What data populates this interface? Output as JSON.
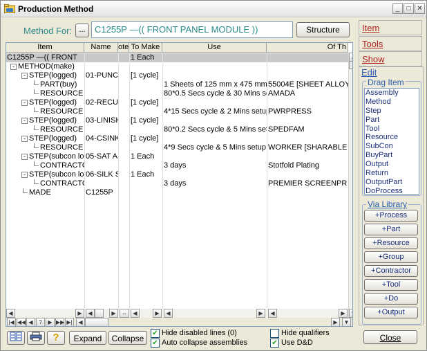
{
  "window": {
    "title": "Production Method",
    "controls": [
      "_",
      "□",
      "✕"
    ]
  },
  "method": {
    "label": "Method For:",
    "browse_label": "...",
    "value": "C1255P    —(( FRONT PANEL MODULE ))",
    "structure_label": "Structure"
  },
  "tree": {
    "columns": [
      "Item",
      "Name",
      "ote",
      "To Make",
      "Use",
      "Of Th"
    ],
    "rows": [
      {
        "item": "C1255P   —(( FRONT",
        "name": "",
        "note": "",
        "tomake": "1 Each",
        "use": "",
        "of": "",
        "indent": 0,
        "expander": "",
        "selected": true
      },
      {
        "item": "METHOD(make)",
        "name": "",
        "note": "",
        "tomake": "",
        "use": "",
        "of": "",
        "indent": 1,
        "expander": "-"
      },
      {
        "item": "STEP(logged)",
        "name": "01-PUNC",
        "note": "",
        "tomake": "[1 cycle]",
        "use": "",
        "of": "",
        "indent": 2,
        "expander": "-"
      },
      {
        "item": "PART(buy)",
        "name": "",
        "note": "",
        "tomake": "",
        "use": "1 Sheets of 125 mm x 475 mm",
        "of": "55004E [SHEET ALLOY",
        "indent": 3,
        "expander": ""
      },
      {
        "item": "RESOURCE",
        "name": "",
        "note": "",
        "tomake": "",
        "use": "80*0.5 Secs cycle & 30 Mins se",
        "of": "AMADA",
        "indent": 3,
        "expander": ""
      },
      {
        "item": "STEP(logged)",
        "name": "02-RECU",
        "note": "",
        "tomake": "[1 cycle]",
        "use": "",
        "of": "",
        "indent": 2,
        "expander": "-"
      },
      {
        "item": "RESOURCE",
        "name": "",
        "note": "",
        "tomake": "",
        "use": "4*15 Secs cycle & 2 Mins setup",
        "of": "PWRPRESS",
        "indent": 3,
        "expander": ""
      },
      {
        "item": "STEP(logged)",
        "name": "03-LINISH",
        "note": "",
        "tomake": "[1 cycle]",
        "use": "",
        "of": "",
        "indent": 2,
        "expander": "-"
      },
      {
        "item": "RESOURCE",
        "name": "",
        "note": "",
        "tomake": "",
        "use": "80*0.2 Secs cycle & 5 Mins setu",
        "of": "SPEDFAM",
        "indent": 3,
        "expander": ""
      },
      {
        "item": "STEP(logged)",
        "name": "04-CSINK",
        "note": "",
        "tomake": "[1 cycle]",
        "use": "",
        "of": "",
        "indent": 2,
        "expander": "-"
      },
      {
        "item": "RESOURCE",
        "name": "",
        "note": "",
        "tomake": "",
        "use": "4*9 Secs cycle & 5 Mins setup",
        "of": "WORKER [SHARABLE",
        "indent": 3,
        "expander": ""
      },
      {
        "item": "STEP(subcon lo",
        "name": "05-SAT A",
        "note": "",
        "tomake": "1 Each",
        "use": "",
        "of": "",
        "indent": 2,
        "expander": "-"
      },
      {
        "item": "CONTRACTO",
        "name": "",
        "note": "",
        "tomake": "",
        "use": "3 days",
        "of": "Stotfold Plating",
        "indent": 3,
        "expander": ""
      },
      {
        "item": "STEP(subcon lo",
        "name": "06-SILK S",
        "note": "",
        "tomake": "1 Each",
        "use": "",
        "of": "",
        "indent": 2,
        "expander": "-"
      },
      {
        "item": "CONTRACTO",
        "name": "",
        "note": "",
        "tomake": "",
        "use": "3 days",
        "of": "PREMIER SCREENPR",
        "indent": 3,
        "expander": ""
      },
      {
        "item": "MADE",
        "name": "C1255P",
        "note": "",
        "tomake": "",
        "use": "",
        "of": "",
        "indent": 2,
        "expander": ""
      }
    ],
    "nav": [
      "|◀",
      "◀◀",
      "◀",
      "?",
      "▶",
      "▶▶",
      "▶|"
    ]
  },
  "right_tabs": {
    "item": "Item",
    "tools": "Tools",
    "show": "Show",
    "edit": "Edit"
  },
  "drag": {
    "title": "Drag Item",
    "items": [
      "Assembly",
      "Method",
      "Step",
      "Part",
      "Tool",
      "Resource",
      "SubCon",
      "BuyPart",
      "Output",
      "Return",
      "OutputPart",
      "DoProcess"
    ]
  },
  "library": {
    "title": "Via Library",
    "buttons": [
      "+Process",
      "+Part",
      "+Resource",
      "+Group",
      "+Contractor",
      "+Tool",
      "+Do",
      "+Output"
    ]
  },
  "bottom": {
    "expand_label": "Expand",
    "collapse_label": "Collapse",
    "close_label": "Close",
    "hide_disabled_label": "Hide disabled lines (0)",
    "auto_collapse_label": "Auto collapse assemblies",
    "hide_qualifiers_label": "Hide qualifiers",
    "use_dd_label": "Use D&D",
    "hide_disabled_checked": true,
    "auto_collapse_checked": true,
    "hide_qualifiers_checked": false,
    "use_dd_checked": true
  },
  "colors": {
    "accent_red": "#b02020",
    "teal": "#2a8a8a",
    "navy": "#1a2f7a",
    "check_green": "#21a121"
  }
}
